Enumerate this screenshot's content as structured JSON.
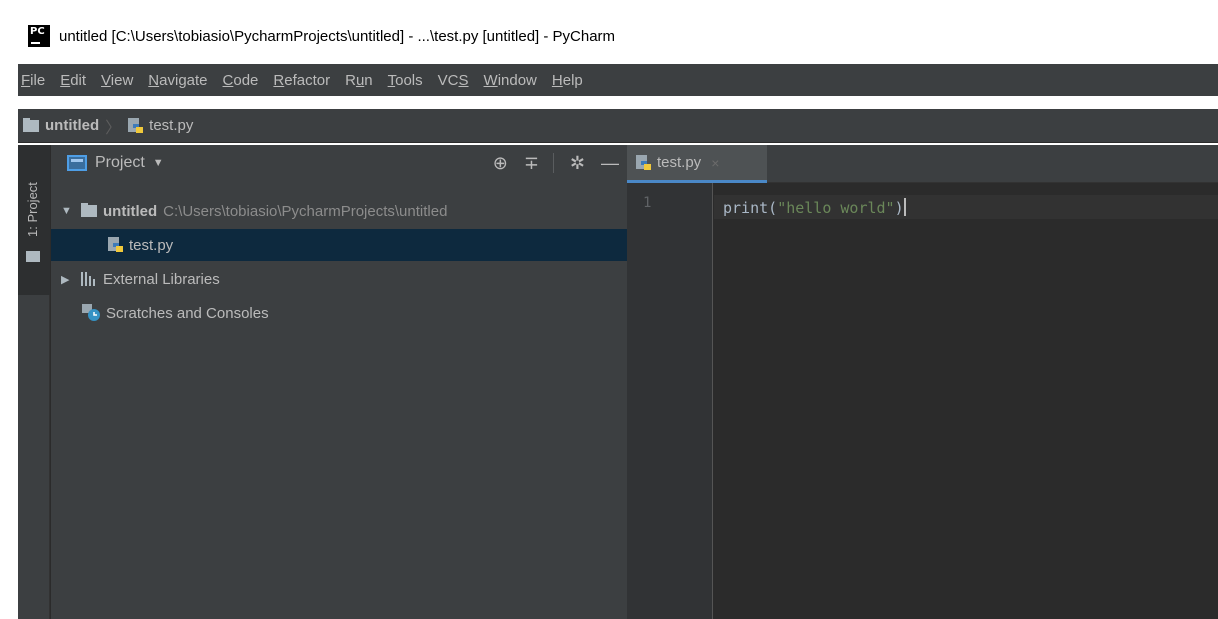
{
  "window": {
    "title": "untitled [C:\\Users\\tobiasio\\PycharmProjects\\untitled] - ...\\test.py [untitled] - PyCharm",
    "app_icon_text": "PC"
  },
  "menu": {
    "items": [
      {
        "pre": "",
        "u": "F",
        "post": "ile"
      },
      {
        "pre": "",
        "u": "E",
        "post": "dit"
      },
      {
        "pre": "",
        "u": "V",
        "post": "iew"
      },
      {
        "pre": "",
        "u": "N",
        "post": "avigate"
      },
      {
        "pre": "",
        "u": "C",
        "post": "ode"
      },
      {
        "pre": "",
        "u": "R",
        "post": "efactor"
      },
      {
        "pre": "R",
        "u": "u",
        "post": "n"
      },
      {
        "pre": "",
        "u": "T",
        "post": "ools"
      },
      {
        "pre": "VC",
        "u": "S",
        "post": ""
      },
      {
        "pre": "",
        "u": "W",
        "post": "indow"
      },
      {
        "pre": "",
        "u": "H",
        "post": "elp"
      }
    ]
  },
  "breadcrumb": {
    "project": "untitled",
    "separator": "〉",
    "file": "test.py"
  },
  "tool_window": {
    "stripe_label": "1: Project",
    "title": "Project",
    "tools": {
      "locate": "⊕",
      "collapse": "∓",
      "settings": "✲",
      "hide": "—"
    },
    "tree": {
      "root_name": "untitled",
      "root_path": "C:\\Users\\tobiasio\\PycharmProjects\\untitled",
      "file": "test.py",
      "external_libraries": "External Libraries",
      "scratches": "Scratches and Consoles"
    }
  },
  "editor": {
    "tab_label": "test.py",
    "tab_close": "×",
    "line_number": "1",
    "code_func": "print(",
    "code_string": "\"hello world\"",
    "code_close": ")"
  },
  "colors": {
    "bg_dark": "#2b2b2b",
    "panel": "#3c3f41",
    "selection": "#0d293e",
    "tab_underline": "#4a88c7",
    "string": "#6a8759",
    "text": "#bbbbbb"
  }
}
